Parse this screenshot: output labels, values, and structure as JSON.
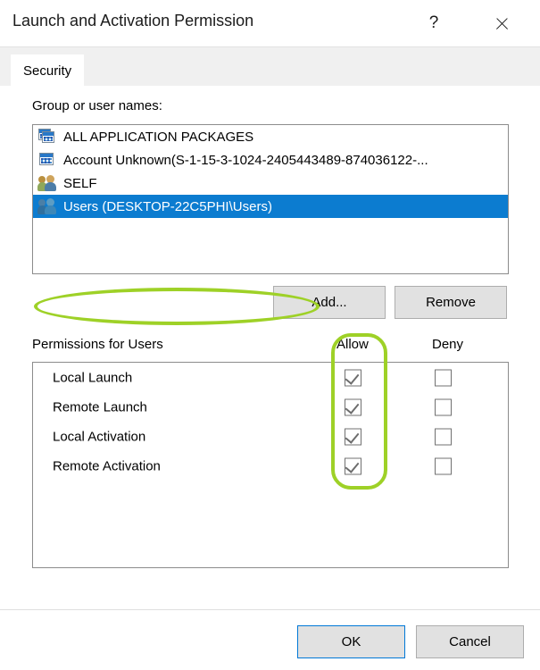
{
  "window": {
    "title": "Launch and Activation Permission",
    "help_icon": "question-mark-icon",
    "close_icon": "close-icon",
    "help_label": "?"
  },
  "tabs": [
    {
      "label": "Security",
      "active": true
    }
  ],
  "group_section": {
    "label": "Group or user names:",
    "items": [
      {
        "name": "ALL APPLICATION PACKAGES",
        "icon": "application-package-icon",
        "selected": false
      },
      {
        "name": "Account Unknown(S-1-15-3-1024-2405443489-874036122-...",
        "icon": "application-package-icon",
        "selected": false
      },
      {
        "name": "SELF",
        "icon": "users-group-icon",
        "selected": false
      },
      {
        "name": "Users (DESKTOP-22C5PHI\\Users)",
        "icon": "users-group-icon",
        "selected": true
      }
    ]
  },
  "buttons": {
    "add": "Add...",
    "remove": "Remove",
    "ok": "OK",
    "cancel": "Cancel"
  },
  "permissions_section": {
    "label": "Permissions for Users",
    "columns": [
      "Allow",
      "Deny"
    ],
    "rows": [
      {
        "name": "Local Launch",
        "allow": true,
        "deny": false
      },
      {
        "name": "Remote Launch",
        "allow": true,
        "deny": false
      },
      {
        "name": "Local Activation",
        "allow": true,
        "deny": false
      },
      {
        "name": "Remote Activation",
        "allow": true,
        "deny": false
      }
    ]
  },
  "annotations": {
    "color": "#9ED127",
    "shapes": [
      "ellipse-around-selected-user",
      "rounded-rect-around-allow-column"
    ]
  },
  "colors": {
    "selection_blue": "#0C7CD0",
    "accent_focus": "#0078D7",
    "annotation_green": "#9ED127",
    "button_face": "#E1E1E1"
  }
}
